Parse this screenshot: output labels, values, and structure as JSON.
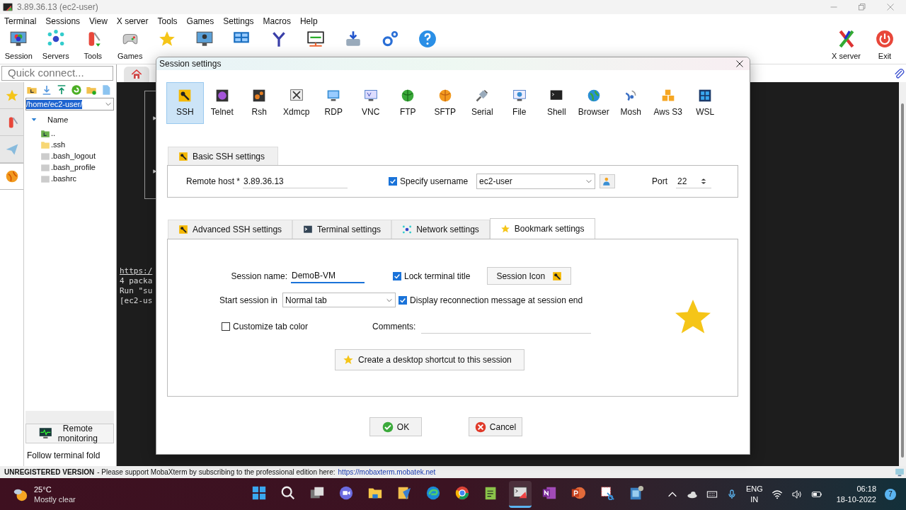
{
  "window": {
    "title": "3.89.36.13 (ec2-user)"
  },
  "menu": [
    "Terminal",
    "Sessions",
    "View",
    "X server",
    "Tools",
    "Games",
    "Settings",
    "Macros",
    "Help"
  ],
  "toolbar": [
    {
      "label": "Session"
    },
    {
      "label": "Servers"
    },
    {
      "label": "Tools"
    },
    {
      "label": "Games"
    }
  ],
  "toolbar_right": [
    {
      "label": "X server"
    },
    {
      "label": "Exit"
    }
  ],
  "quick_connect": {
    "placeholder": "Quick connect..."
  },
  "side_tabs": [
    {
      "selected": false
    },
    {
      "selected": false
    },
    {
      "selected": false
    },
    {
      "selected": true
    }
  ],
  "file_panel": {
    "path": "/home/ec2-user/",
    "column": "Name",
    "files": [
      {
        "name": "..",
        "kind": "up"
      },
      {
        "name": ".ssh",
        "kind": "folder"
      },
      {
        "name": ".bash_logout",
        "kind": "file"
      },
      {
        "name": ".bash_profile",
        "kind": "file"
      },
      {
        "name": ".bashrc",
        "kind": "file"
      }
    ],
    "remote_monitoring": "Remote monitoring",
    "follow": "Follow terminal fold"
  },
  "terminal": {
    "lines": [
      "https:/",
      "4 packa",
      "Run \"su",
      "[ec2-us"
    ]
  },
  "dialog": {
    "title": "Session settings",
    "session_types": [
      {
        "label": "SSH",
        "selected": true
      },
      {
        "label": "Telnet",
        "selected": false
      },
      {
        "label": "Rsh",
        "selected": false
      },
      {
        "label": "Xdmcp",
        "selected": false
      },
      {
        "label": "RDP",
        "selected": false
      },
      {
        "label": "VNC",
        "selected": false
      },
      {
        "label": "FTP",
        "selected": false
      },
      {
        "label": "SFTP",
        "selected": false
      },
      {
        "label": "Serial",
        "selected": false
      },
      {
        "label": "File",
        "selected": false
      },
      {
        "label": "Shell",
        "selected": false
      },
      {
        "label": "Browser",
        "selected": false
      },
      {
        "label": "Mosh",
        "selected": false
      },
      {
        "label": "Aws S3",
        "selected": false
      },
      {
        "label": "WSL",
        "selected": false
      }
    ],
    "basic_tab": "Basic SSH settings",
    "remote_host": {
      "label": "Remote host *",
      "value": "3.89.36.13"
    },
    "specify_username": {
      "label": "Specify username",
      "checked": true
    },
    "username": "ec2-user",
    "port": {
      "label": "Port",
      "value": "22"
    },
    "tabs": [
      {
        "label": "Advanced SSH settings",
        "selected": false
      },
      {
        "label": "Terminal settings",
        "selected": false
      },
      {
        "label": "Network settings",
        "selected": false
      },
      {
        "label": "Bookmark settings",
        "selected": true
      }
    ],
    "session_name": {
      "label": "Session name:",
      "value": "DemoB-VM"
    },
    "lock_title": {
      "label": "Lock terminal title",
      "checked": true
    },
    "session_icon": "Session Icon",
    "start_session": {
      "label": "Start session in",
      "value": "Normal tab"
    },
    "reconnect": {
      "label": "Display reconnection message at session end",
      "checked": true
    },
    "tab_color": {
      "label": "Customize tab color",
      "checked": false
    },
    "comments": {
      "label": "Comments:"
    },
    "shortcut": "Create a desktop shortcut to this session",
    "ok": "OK",
    "cancel": "Cancel"
  },
  "status_bar": {
    "title": "UNREGISTERED VERSION",
    "message": "- Please support MobaXterm by subscribing to the professional edition here:",
    "link": "https://mobaxterm.mobatek.net"
  },
  "taskbar": {
    "temperature": "25°C",
    "condition": "Mostly clear",
    "apps": [
      {
        "selected": false
      },
      {
        "selected": false
      },
      {
        "selected": false
      },
      {
        "selected": false
      },
      {
        "selected": false
      },
      {
        "selected": false
      },
      {
        "selected": false
      },
      {
        "selected": false
      },
      {
        "selected": false
      },
      {
        "selected": true
      },
      {
        "selected": false
      },
      {
        "selected": false
      },
      {
        "selected": false
      },
      {
        "selected": false
      }
    ],
    "language": "ENG",
    "region": "IN",
    "time": "06:18",
    "date": "18-10-2022",
    "badge": "7"
  }
}
